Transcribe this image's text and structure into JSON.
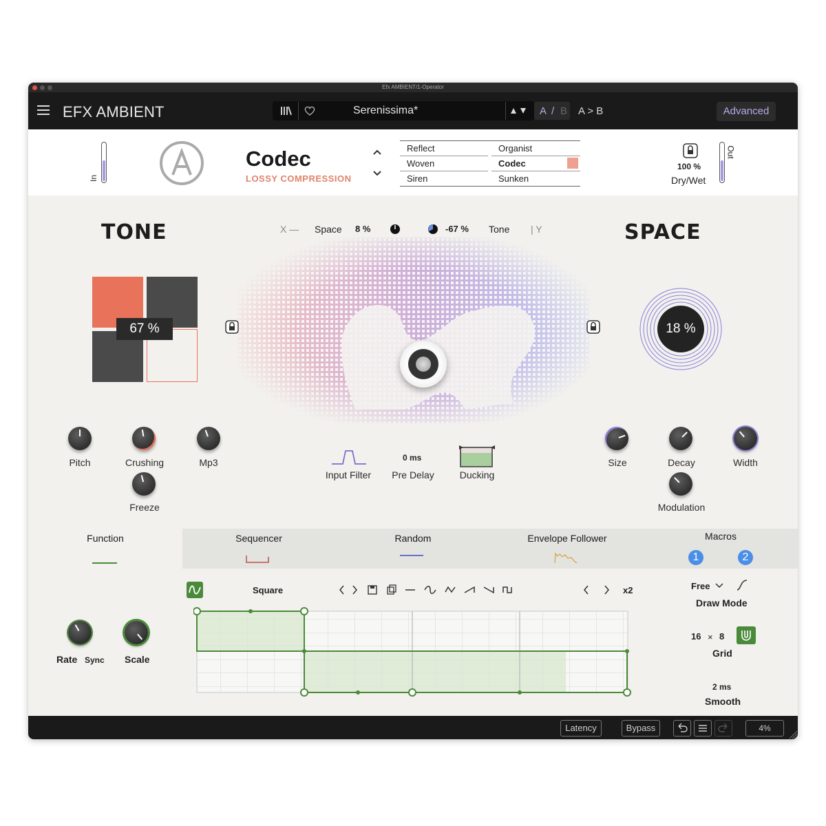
{
  "window": {
    "title": "Efx AMBIENT/1-Operator"
  },
  "topbar": {
    "brand": "EFX AMBIENT",
    "preset_name": "Serenissima*",
    "ab_a": "A",
    "ab_slash": "/",
    "ab_b": "B",
    "ab_copy": "A > B",
    "advanced": "Advanced"
  },
  "header": {
    "in_label": "In",
    "out_label": "Out",
    "fx_name": "Codec",
    "fx_sub": "LOSSY COMPRESSION",
    "presets_left": [
      "Reflect",
      "Woven",
      "Siren"
    ],
    "presets_right": [
      "Organist",
      "Codec",
      "Sunken"
    ],
    "selected_color": "#f0a090",
    "drywet_value": "100 %",
    "drywet_label": "Dry/Wet"
  },
  "tone": {
    "title": "TONE",
    "value": "67 %",
    "accent": "#e8735a"
  },
  "space": {
    "title": "SPACE",
    "value": "18 %"
  },
  "xy": {
    "x_label": "X —",
    "space_label": "Space",
    "space_value": "8 %",
    "tone_value": "-67 %",
    "tone_label": "Tone",
    "y_label": "| Y"
  },
  "tone_knobs": {
    "pitch": "Pitch",
    "crushing": "Crushing",
    "mp3": "Mp3",
    "freeze": "Freeze"
  },
  "center_controls": {
    "input_filter": "Input Filter",
    "predelay_value": "0 ms",
    "predelay_label": "Pre Delay",
    "ducking": "Ducking"
  },
  "space_knobs": {
    "size": "Size",
    "decay": "Decay",
    "width": "Width",
    "modulation": "Modulation"
  },
  "mod_tabs": {
    "function": "Function",
    "sequencer": "Sequencer",
    "random": "Random",
    "envelope": "Envelope Follower",
    "macros": "Macros",
    "macro1": "1",
    "macro2": "2"
  },
  "function_panel": {
    "shape_name": "Square",
    "multiplier": "x2",
    "rate_label": "Rate",
    "sync_label": "Sync",
    "scale_label": "Scale",
    "free_label": "Free",
    "draw_mode": "Draw Mode",
    "grid_x": "16",
    "grid_times": "×",
    "grid_y": "8",
    "grid_label": "Grid",
    "smooth_value": "2 ms",
    "smooth_label": "Smooth",
    "accent": "#4a8a3a"
  },
  "footer": {
    "latency": "Latency",
    "bypass": "Bypass",
    "cpu": "4%"
  }
}
